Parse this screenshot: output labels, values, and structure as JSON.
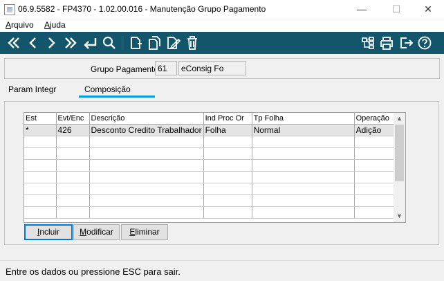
{
  "window": {
    "title": "06.9.5582 - FP4370 - 1.02.00.016 - Manutenção Grupo Pagamento",
    "min_glyph": "—",
    "max_glyph": "☐",
    "close_glyph": "✕"
  },
  "menu": [
    {
      "hot": "A",
      "rest": "rquivo"
    },
    {
      "hot": "A",
      "rest": "juda"
    }
  ],
  "toolbar": {
    "background": "#13566b",
    "icons": [
      "first-record-icon",
      "previous-record-icon",
      "next-record-icon",
      "last-record-icon",
      "enter-icon",
      "search-icon",
      "new-document-icon",
      "copy-document-icon",
      "edit-document-icon",
      "delete-icon",
      "tree-icon",
      "print-icon",
      "exit-icon",
      "help-icon"
    ]
  },
  "header": {
    "grupo_label": "Grupo Pagamento:",
    "grupo_code": "61",
    "grupo_name": "eConsig Fo"
  },
  "tabs": [
    {
      "label": "Param Integr",
      "active": false
    },
    {
      "label": "Composição",
      "active": true
    }
  ],
  "grid": {
    "columns": [
      "Est",
      "Evt/Enc",
      "Descrição",
      "Ind Proc Or",
      "Tp Folha",
      "Operação"
    ],
    "rows": [
      [
        "*",
        "426",
        "Desconto Credito Trabalhador",
        "Folha",
        "Normal",
        "Adição"
      ],
      [
        "",
        "",
        "",
        "",
        "",
        ""
      ],
      [
        "",
        "",
        "",
        "",
        "",
        ""
      ],
      [
        "",
        "",
        "",
        "",
        "",
        ""
      ],
      [
        "",
        "",
        "",
        "",
        "",
        ""
      ],
      [
        "",
        "",
        "",
        "",
        "",
        ""
      ],
      [
        "",
        "",
        "",
        "",
        "",
        ""
      ],
      [
        "",
        "",
        "",
        "",
        "",
        ""
      ]
    ]
  },
  "buttons": {
    "incluir": {
      "hot": "I",
      "rest": "ncluir"
    },
    "modificar": {
      "hot": "M",
      "rest": "odificar"
    },
    "eliminar": {
      "hot": "E",
      "rest": "liminar"
    }
  },
  "status": {
    "text": "Entre os dados ou pressione ESC para sair."
  }
}
